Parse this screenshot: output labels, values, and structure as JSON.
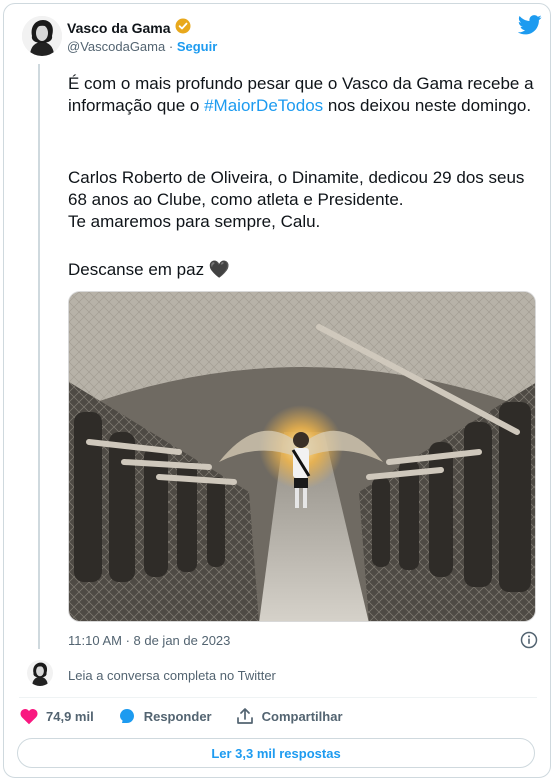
{
  "author": {
    "name": "Vasco da Gama",
    "handle": "@VascodaGama",
    "separator": "·",
    "follow_label": "Seguir",
    "verified_icon": "verified-badge-icon"
  },
  "tweet": {
    "para1_prefix": "É com o mais profundo pesar que o Vasco da Gama recebe a informação que o ",
    "hashtag": "#MaiorDeTodos",
    "para1_suffix": " nos deixou neste domingo.",
    "para2": "Carlos Roberto de Oliveira, o Dinamite, dedicou 29 dos seus 68 anos ao Clube, como atleta e Presidente.\nTe amaremos para sempre, Calu.",
    "para3": "Descanse em paz",
    "heart_emoji": "🖤",
    "timestamp": "11:10 AM · 8 de jan de 2023"
  },
  "conversation_link": "Leia a conversa completa no Twitter",
  "actions": {
    "likes": "74,9 mil",
    "reply": "Responder",
    "share": "Compartilhar"
  },
  "replies_button": "Ler 3,3 mil respostas",
  "colors": {
    "accent": "#1d9bf0",
    "like": "#f91880",
    "muted": "#536471",
    "verified": "#e8a81c"
  }
}
